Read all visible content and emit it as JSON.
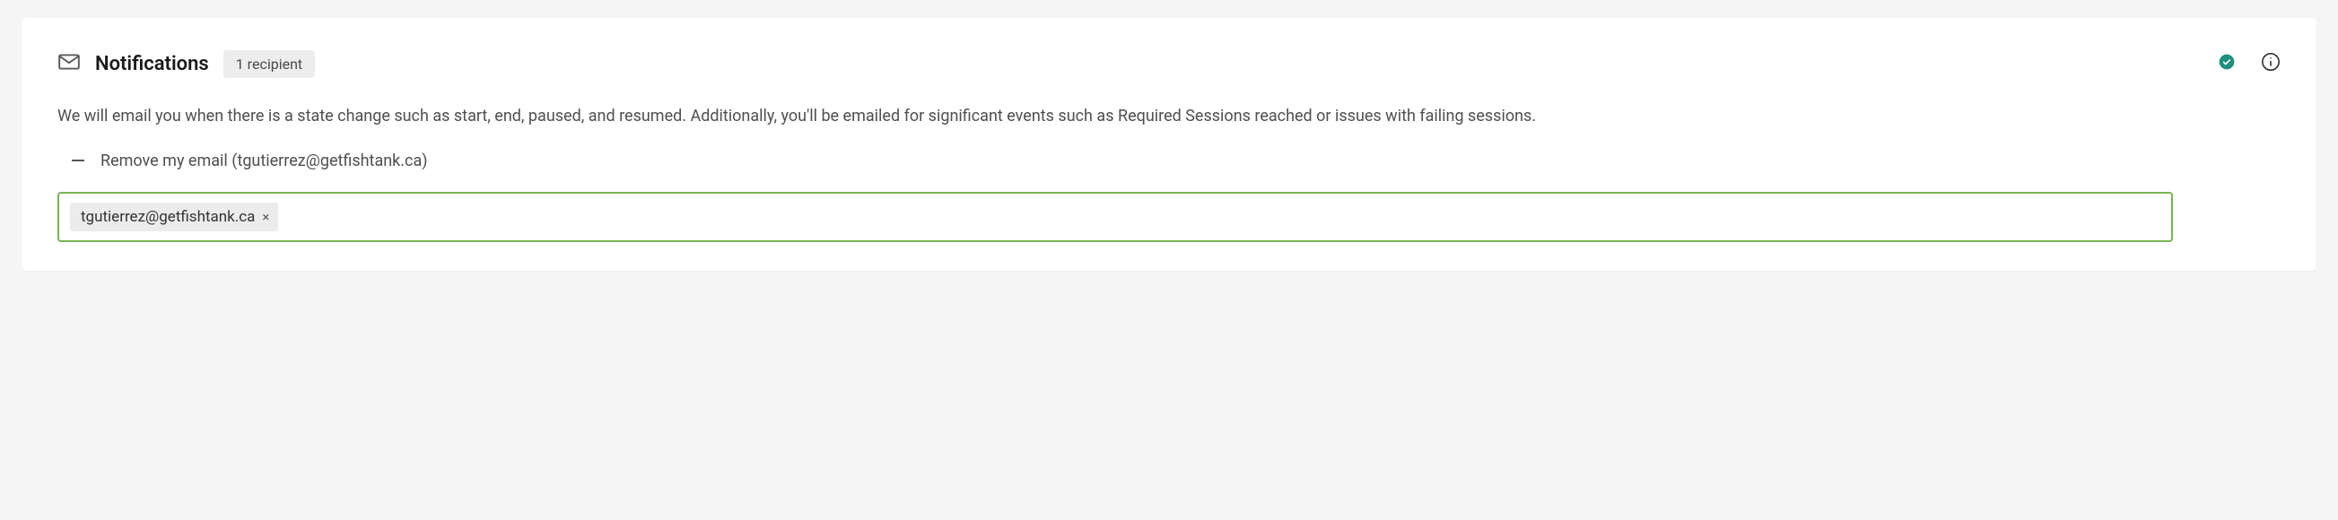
{
  "header": {
    "title": "Notifications",
    "recipient_badge": "1 recipient"
  },
  "description": "We will email you when there is a state change such as start, end, paused, and resumed. Additionally, you'll be emailed for significant events such as Required Sessions reached or issues with failing sessions.",
  "remove_action": {
    "label": "Remove my email (tgutierrez@getfishtank.ca)"
  },
  "email_input": {
    "chips": [
      {
        "email": "tgutierrez@getfishtank.ca"
      }
    ]
  },
  "icons": {
    "envelope": "envelope-icon",
    "check": "checkmark-circle-icon",
    "info": "info-circle-icon",
    "minus": "minus-icon",
    "chip_close": "×"
  }
}
